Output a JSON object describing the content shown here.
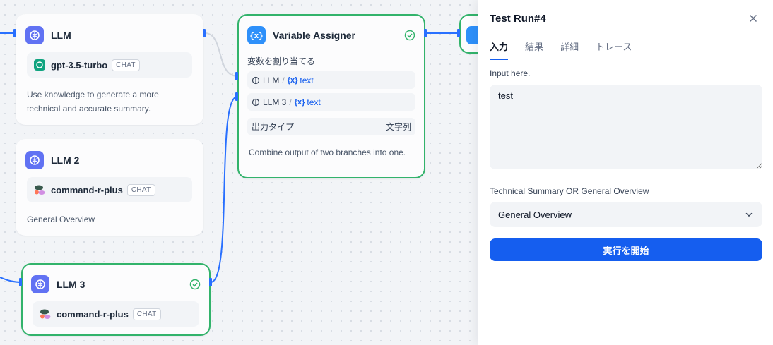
{
  "nodes": {
    "llm1": {
      "title": "LLM",
      "model": "gpt-3.5-turbo",
      "model_tag": "CHAT",
      "description": "Use knowledge to generate a more technical and accurate summary.",
      "icon": "llm-brain-icon",
      "model_logo": "openai-logo-icon"
    },
    "llm2": {
      "title": "LLM 2",
      "model": "command-r-plus",
      "model_tag": "CHAT",
      "description": "General Overview",
      "icon": "llm-brain-icon",
      "model_logo": "cohere-logo-icon"
    },
    "llm3": {
      "title": "LLM 3",
      "model": "command-r-plus",
      "model_tag": "CHAT",
      "icon": "llm-brain-icon",
      "model_logo": "cohere-logo-icon",
      "status": "success"
    },
    "variable_assigner": {
      "title": "Variable Assigner",
      "icon": "variable-icon",
      "status": "success",
      "assign_label": "変数を割り当てる",
      "variables": [
        {
          "node": "LLM",
          "separator": "/",
          "var_icon": "{x}",
          "var": "text"
        },
        {
          "node": "LLM 3",
          "separator": "/",
          "var_icon": "{x}",
          "var": "text"
        }
      ],
      "output_type_label": "出力タイプ",
      "output_type_value": "文字列",
      "description": "Combine output of two branches into one."
    }
  },
  "panel": {
    "title": "Test Run#4",
    "tabs": [
      {
        "label": "入力",
        "active": true
      },
      {
        "label": "結果",
        "active": false
      },
      {
        "label": "詳細",
        "active": false
      },
      {
        "label": "トレース",
        "active": false
      }
    ],
    "input_label": "Input here.",
    "input_value": "test",
    "select_label": "Technical Summary OR General Overview",
    "select_value": "General Overview",
    "run_button": "実行を開始"
  },
  "colors": {
    "accent": "#155eef",
    "success": "#32b36b",
    "llm_icon_bg": "#6172f3",
    "variable_icon_bg": "#2e90fa",
    "edge": "#2970ff"
  }
}
